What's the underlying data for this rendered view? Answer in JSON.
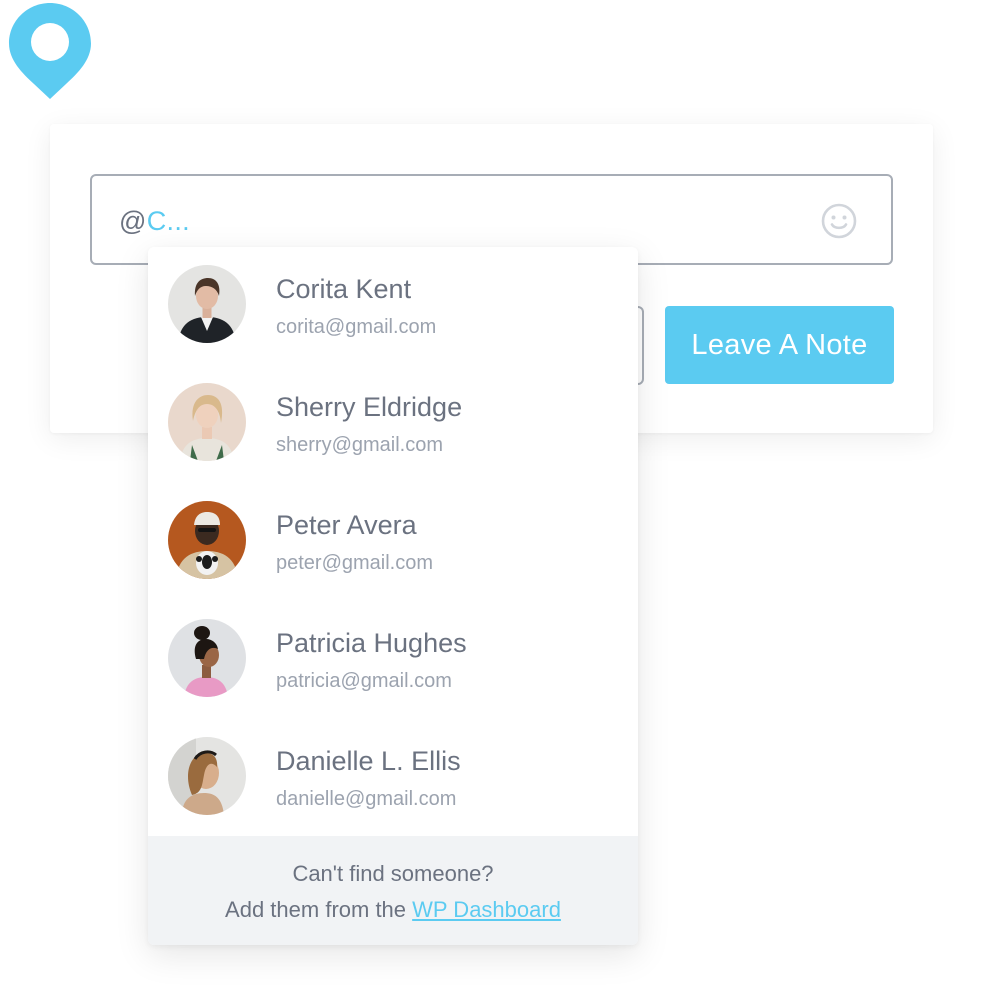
{
  "input": {
    "prefix": "@",
    "query": "C..."
  },
  "actions": {
    "leave_note_label": "Leave A Note"
  },
  "icons": {
    "pin": "map-pin-icon",
    "emoji": "smiley-face-icon"
  },
  "colors": {
    "accent": "#5bcbf1",
    "text": "#6b7280",
    "muted_text": "#9ca3af",
    "border": "#a7adb6",
    "footer_bg": "#f1f3f5"
  },
  "mentions": [
    {
      "name": "Corita Kent",
      "email": "corita@gmail.com"
    },
    {
      "name": "Sherry Eldridge",
      "email": "sherry@gmail.com"
    },
    {
      "name": "Peter Avera",
      "email": "peter@gmail.com"
    },
    {
      "name": "Patricia Hughes",
      "email": "patricia@gmail.com"
    },
    {
      "name": "Danielle L. Ellis",
      "email": "danielle@gmail.com"
    }
  ],
  "footer": {
    "question": "Can't find someone?",
    "prompt": "Add them from the",
    "link_label": "WP Dashboard"
  }
}
